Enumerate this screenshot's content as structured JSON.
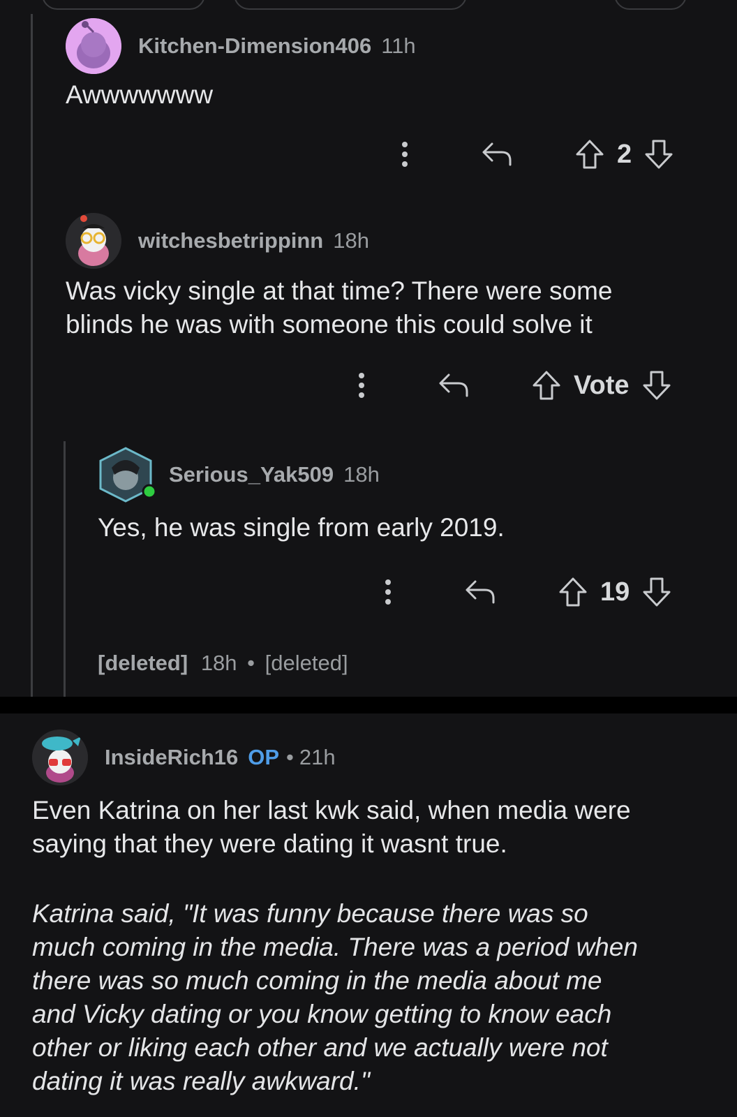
{
  "comments": [
    {
      "username": "KitchenDimension",
      "username_text": "Kitchen-Dimension406",
      "age": "11h",
      "body": "Awwwwwww",
      "score": "2"
    },
    {
      "username_text": "witchesbetrippinn",
      "age": "18h",
      "body_line1": "Was vicky single at that time? There were some",
      "body_line2": "blinds he was with someone this could solve it",
      "score": "Vote"
    },
    {
      "username_text": "Serious_Yak509",
      "age": "18h",
      "body": "Yes, he was single from early 2019.",
      "score": "19"
    }
  ],
  "deleted": {
    "user": "[deleted]",
    "age": "18h",
    "sep": "•",
    "body": "[deleted]"
  },
  "op_comment": {
    "username_text": "InsideRich16",
    "op_label": "OP",
    "sep": "•",
    "age": "21h",
    "body_line1": "Even Katrina on her last kwk said, when media were",
    "body_line2": "saying that they were dating it wasnt true.",
    "quote_lines": [
      "Katrina said, \"It was funny because there was so",
      "much coming in the media. There was a period when",
      "there was so much coming in the media about me",
      "and Vicky dating or you know getting to know each",
      "other or liking each other and we actually were not",
      "dating it was really awkward.\""
    ]
  },
  "icons": {
    "more": "more-vertical-icon",
    "reply": "reply-icon",
    "upvote": "upvote-icon",
    "downvote": "downvote-icon"
  },
  "colors": {
    "background": "#131315",
    "op": "#4f9de8",
    "online": "#2ecc40"
  }
}
